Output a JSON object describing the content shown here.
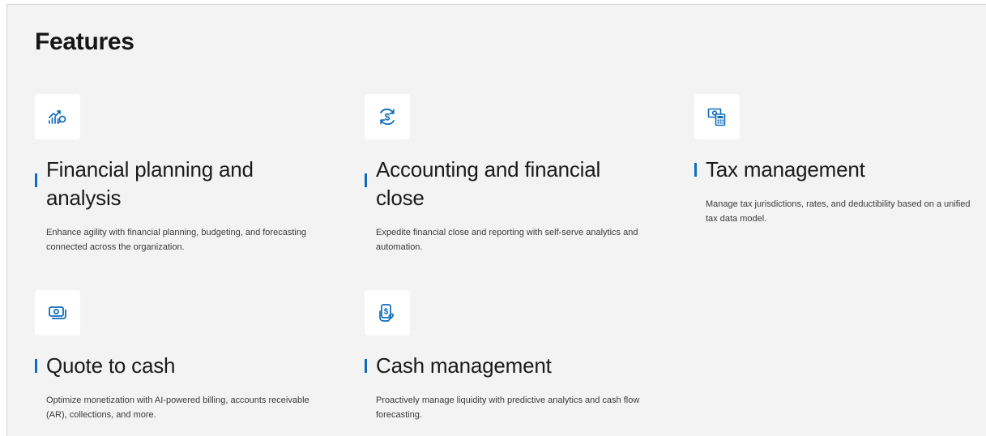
{
  "page": {
    "title": "Features"
  },
  "features": [
    {
      "title": "Financial planning and analysis",
      "description": "Enhance agility with financial planning, budgeting, and forecasting connected across the organization.",
      "icon": "chart-search-icon"
    },
    {
      "title": "Accounting and financial close",
      "description": "Expedite financial close and reporting with self-serve analytics and automation.",
      "icon": "currency-sync-icon"
    },
    {
      "title": "Tax management",
      "description": "Manage tax jurisdictions, rates, and deductibility based on a unified tax data model.",
      "icon": "money-calculator-icon"
    },
    {
      "title": "Quote to cash",
      "description": "Optimize monetization with AI-powered billing, accounts receivable (AR), collections, and more.",
      "icon": "money-stack-icon"
    },
    {
      "title": "Cash management",
      "description": "Proactively manage liquidity with predictive analytics and cash flow forecasting.",
      "icon": "hand-money-icon"
    }
  ],
  "colors": {
    "accent": "#0f6cbd",
    "background": "#f3f3f3",
    "tile": "#ffffff",
    "heading": "#161616"
  }
}
